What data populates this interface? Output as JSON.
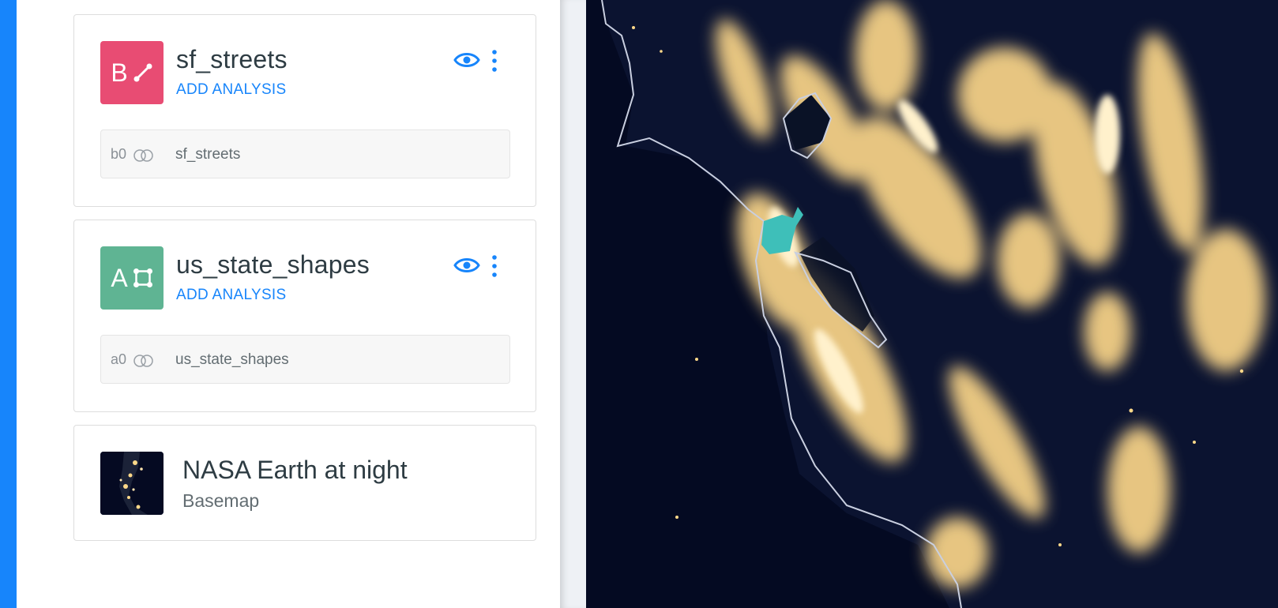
{
  "layers": [
    {
      "letter": "B",
      "title": "sf_streets",
      "add_analysis": "ADD ANALYSIS",
      "badge_color": "#e84c73",
      "geometry_icon": "line-geometry-icon",
      "source_id": "b0",
      "source_name": "sf_streets"
    },
    {
      "letter": "A",
      "title": "us_state_shapes",
      "add_analysis": "ADD ANALYSIS",
      "badge_color": "#5fb493",
      "geometry_icon": "polygon-geometry-icon",
      "source_id": "a0",
      "source_name": "us_state_shapes"
    }
  ],
  "basemap": {
    "title": "NASA Earth at night",
    "subtitle": "Basemap"
  },
  "colors": {
    "accent": "#1785fb",
    "map_background": "#040a22",
    "city_lights": "#ffd98a",
    "highlight_polygon": "#3ebfb9"
  }
}
